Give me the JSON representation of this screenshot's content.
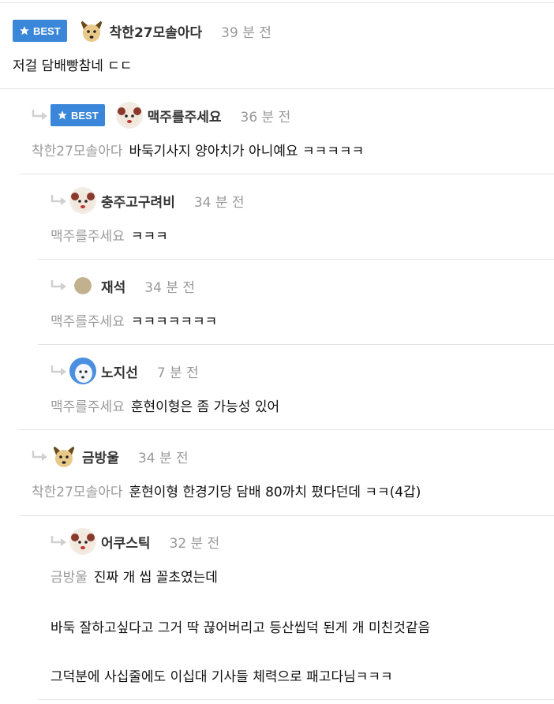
{
  "best_label": "BEST",
  "comments": [
    {
      "user": "착한27모솔아다",
      "time": "39 분 전",
      "mention": "",
      "lines": [
        "저걸 담배빵참네 ㄷㄷ"
      ]
    },
    {
      "user": "맥주를주세요",
      "time": "36 분 전",
      "mention": "착한27모솔아다",
      "lines": [
        "바둑기사지 양아치가 아니예요 ㅋㅋㅋㅋㅋ"
      ]
    },
    {
      "user": "충주고구려비",
      "time": "34 분 전",
      "mention": "맥주를주세요",
      "lines": [
        "ㅋㅋㅋ"
      ]
    },
    {
      "user": "재석",
      "time": "34 분 전",
      "mention": "맥주를주세요",
      "lines": [
        "ㅋㅋㅋㅋㅋㅋㅋ"
      ]
    },
    {
      "user": "노지선",
      "time": "7 분 전",
      "mention": "맥주를주세요",
      "lines": [
        "훈현이형은 좀 가능성 있어"
      ]
    },
    {
      "user": "금방울",
      "time": "34 분 전",
      "mention": "착한27모솔아다",
      "lines": [
        "훈현이형 한경기당 담배 80까치 폈다던데 ㅋㅋ(4갑)"
      ]
    },
    {
      "user": "어쿠스틱",
      "time": "32 분 전",
      "mention": "금방울",
      "lines": [
        "진짜 개 씹 꼴초였는데",
        "바둑 잘하고싶다고 그거 딱 끊어버리고 등산씹덕 된게 개 미친것같음",
        "그덕분에 사십줄에도 이십대 기사들 체력으로 패고다님ㅋㅋㅋ"
      ]
    }
  ]
}
